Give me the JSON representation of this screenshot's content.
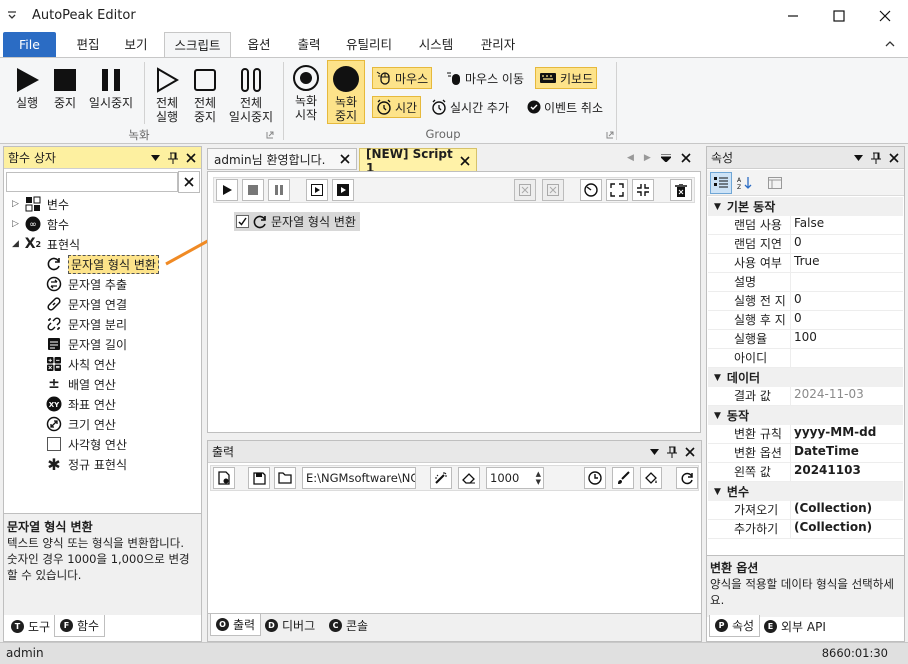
{
  "app": {
    "title": "AutoPeak Editor"
  },
  "ribbon_tabs": [
    "File",
    "편집",
    "보기",
    "스크립트",
    "옵션",
    "출력",
    "유틸리티",
    "시스템",
    "관리자"
  ],
  "ribbon": {
    "run": "실행",
    "stop": "중지",
    "pause": "일시중지",
    "run_all": [
      "전체",
      "실행"
    ],
    "stop_all": [
      "전체",
      "중지"
    ],
    "pause_all": [
      "전체",
      "일시중지"
    ],
    "group1_label": "녹화",
    "rec_start": [
      "녹화",
      "시작"
    ],
    "rec_stop": [
      "녹화",
      "중지"
    ],
    "mouse": "마우스",
    "mouse_move": "마우스 이동",
    "keyboard": "키보드",
    "time": "시간",
    "realtime_add": "실시간 추가",
    "event_cancel": "이벤트 취소",
    "group2_label": "Group"
  },
  "left_panel": {
    "title": "함수 상자",
    "search_value": "",
    "tree": {
      "variables": "변수",
      "functions": "함수",
      "expressions": "표현식",
      "children": [
        "문자열 형식 변환",
        "문자열 추출",
        "문자열 연결",
        "문자열 분리",
        "문자열 길이",
        "사칙 연산",
        "배열 연산",
        "좌표 연산",
        "크기 연산",
        "사각형 연산",
        "정규 표현식"
      ]
    },
    "desc_title": "문자열 형식 변환",
    "desc_text": "텍스트 양식 또는 형식을 변환합니다. 숫자인 경우 1000을 1,000으로 변경할 수 있습니다.",
    "tabs": [
      {
        "badge": "T",
        "label": "도구"
      },
      {
        "badge": "F",
        "label": "함수"
      }
    ]
  },
  "editor": {
    "tabs": [
      "admin님 환영합니다.",
      "[NEW] Script 1"
    ],
    "script_item": "문자열 형식 변환"
  },
  "output": {
    "title": "출력",
    "path": "E:\\NGMsoftware\\NG",
    "count": "1000",
    "tabs": [
      {
        "badge": "O",
        "label": "출력"
      },
      {
        "badge": "D",
        "label": "디버그"
      },
      {
        "badge": "C",
        "label": "콘솔"
      }
    ]
  },
  "properties": {
    "title": "속성",
    "categories": [
      {
        "name": "기본 동작",
        "rows": [
          {
            "name": "랜덤 사용",
            "value": "False",
            "style": "normal"
          },
          {
            "name": "랜덤 지연",
            "value": "0",
            "style": "normal"
          },
          {
            "name": "사용 여부",
            "value": "True",
            "style": "normal"
          },
          {
            "name": "설명",
            "value": "",
            "style": "normal"
          },
          {
            "name": "실행 전 지",
            "value": "0",
            "style": "normal"
          },
          {
            "name": "실행 후 지",
            "value": "0",
            "style": "normal"
          },
          {
            "name": "실행율",
            "value": "100",
            "style": "normal"
          },
          {
            "name": "아이디",
            "value": "",
            "style": "normal"
          }
        ]
      },
      {
        "name": "데이터",
        "rows": [
          {
            "name": "결과 값",
            "value": "2024-11-03",
            "style": "gray"
          }
        ]
      },
      {
        "name": "동작",
        "rows": [
          {
            "name": "변환 규칙",
            "value": "yyyy-MM-dd",
            "style": "bold"
          },
          {
            "name": "변환 옵션",
            "value": "DateTime",
            "style": "bold"
          },
          {
            "name": "왼쪽 값",
            "value": "20241103",
            "style": "bold"
          }
        ]
      },
      {
        "name": "변수",
        "rows": [
          {
            "name": "가져오기",
            "value": "(Collection)",
            "style": "bold"
          },
          {
            "name": "추가하기",
            "value": "(Collection)",
            "style": "bold"
          }
        ]
      }
    ],
    "desc_title": "변환 옵션",
    "desc_text": "양식을 적용할 데이타 형식을 선택하세요.",
    "tabs": [
      {
        "badge": "P",
        "label": "속성"
      },
      {
        "badge": "E",
        "label": "외부 API"
      }
    ]
  },
  "status": {
    "user": "admin",
    "time": "8660:01:30"
  },
  "colors": {
    "accent": "#2b6cc4",
    "highlight": "#fde38a",
    "arrow": "#f08a24",
    "tab_active": "#fff2a8"
  }
}
